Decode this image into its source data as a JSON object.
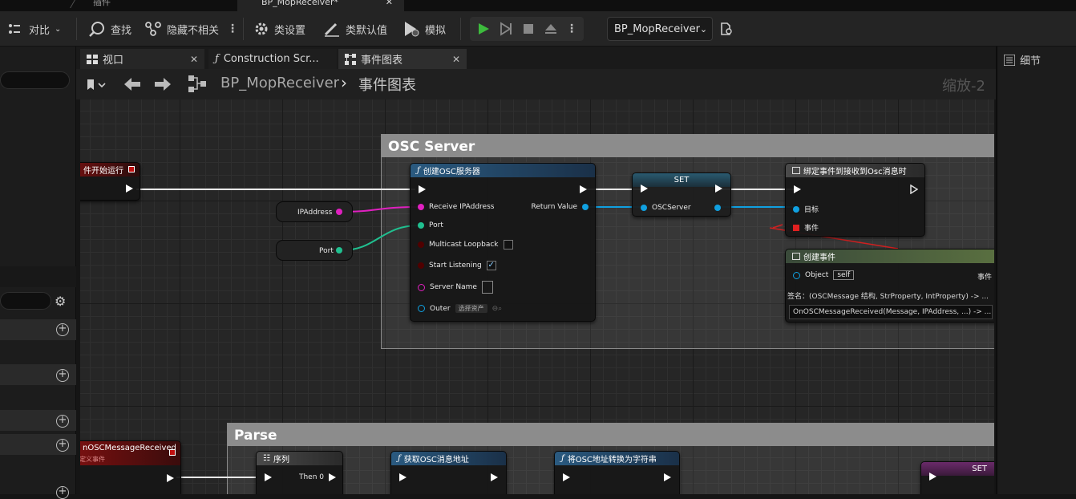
{
  "top_tabs": [
    {
      "label": "插件"
    },
    {
      "label": "BP_MopReceiver*"
    }
  ],
  "toolbar": {
    "diff": "对比",
    "find": "查找",
    "hide_unrelated": "隐藏不相关",
    "class_settings": "类设置",
    "class_defaults": "类默认值",
    "simulate": "模拟",
    "blueprint_select": "BP_MopReceiver"
  },
  "editor_tabs": [
    {
      "label": "视口"
    },
    {
      "label": "Construction Scr..."
    },
    {
      "label": "事件图表"
    }
  ],
  "breadcrumb": {
    "blueprint": "BP_MopReceiver",
    "graph": "事件图表"
  },
  "zoom": "缩放-2",
  "details_title": "细节",
  "comments": {
    "osc_server": "OSC Server",
    "parse": "Parse"
  },
  "nodes": {
    "begin_play": "件开始运行",
    "ip_var": "IPAddress",
    "port_var": "Port",
    "create_server": {
      "title": "创建OSC服务器",
      "pin_ip": "Receive IPAddress",
      "pin_port": "Port",
      "pin_multicast": "Multicast Loopback",
      "pin_listen": "Start Listening",
      "pin_name": "Server Name",
      "pin_outer": "Outer",
      "outer_value": "选择资产",
      "out_return": "Return Value"
    },
    "set_node": {
      "title": "SET",
      "pin": "OSCServer"
    },
    "bind_event": {
      "title": "绑定事件到接收到Osc消息时",
      "pin_target": "目标",
      "pin_event": "事件"
    },
    "create_event": {
      "title": "创建事件",
      "pin_object": "Object",
      "object_value": "self",
      "out_event": "事件",
      "signature": "签名：(OSCMessage 结构, StrProperty, IntProperty) -> ...",
      "function": "OnOSCMessageReceived(Message, IPAddress, ...) -> ..."
    },
    "custom_event": {
      "title": "nOSCMessageReceived",
      "subtitle": "定义事件"
    },
    "sequence": {
      "title": "序列",
      "then0": "Then 0"
    },
    "get_address": {
      "title": "获取OSC消息地址"
    },
    "to_string": {
      "title": "将OSC地址转换为字符串"
    },
    "set_node2": {
      "title": "SET"
    }
  }
}
